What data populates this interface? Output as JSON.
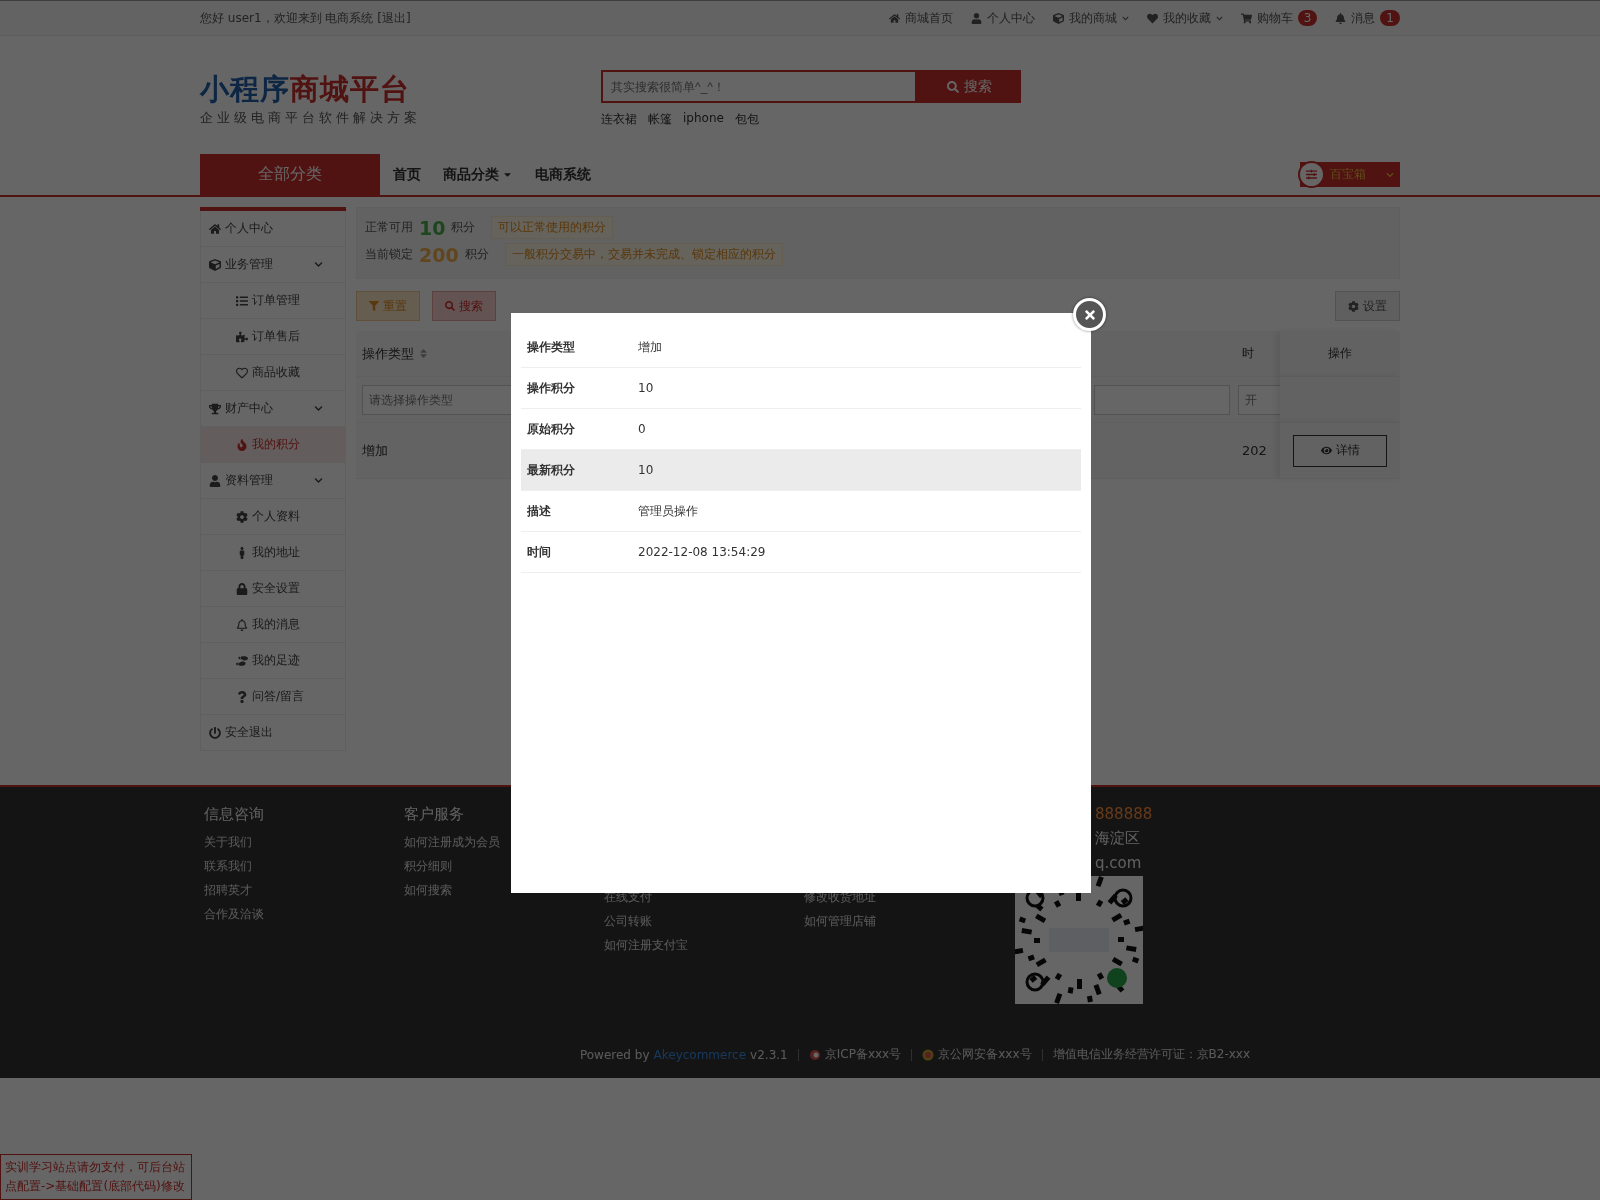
{
  "top_bar": {
    "greeting": "您好 user1，欢迎来到 电商系统",
    "logout": "[退出]",
    "links": [
      {
        "label": "商城首页",
        "dropdown": false
      },
      {
        "label": "个人中心",
        "dropdown": false
      },
      {
        "label": "我的商城",
        "dropdown": true
      },
      {
        "label": "我的收藏",
        "dropdown": true
      },
      {
        "label": "购物车",
        "dropdown": false,
        "badge": "3"
      },
      {
        "label": "消息",
        "dropdown": false,
        "badge": "1"
      }
    ]
  },
  "logo": {
    "title_blue": "小程序",
    "title_red": "商城平台",
    "subtitle": "企业级电商平台软件解决方案"
  },
  "search": {
    "placeholder": "其实搜索很简单^_^！",
    "button": "搜索",
    "hot_words": [
      "连衣裙",
      "帐篷",
      "iphone",
      "包包"
    ]
  },
  "nav": {
    "all_categories": "全部分类",
    "items": [
      {
        "label": "首页",
        "dropdown": false
      },
      {
        "label": "商品分类",
        "dropdown": true
      },
      {
        "label": "电商系统",
        "dropdown": false
      }
    ],
    "toolbox": "百宝箱"
  },
  "sidebar": {
    "items": [
      {
        "label": "个人中心",
        "selected": false
      },
      {
        "label": "业务管理",
        "selected": false,
        "expanded": true,
        "children": [
          {
            "label": "订单管理",
            "selected": false
          },
          {
            "label": "订单售后",
            "selected": false
          },
          {
            "label": "商品收藏",
            "selected": false
          }
        ]
      },
      {
        "label": "财产中心",
        "selected": false,
        "expanded": true,
        "children": [
          {
            "label": "我的积分",
            "selected": true
          }
        ]
      },
      {
        "label": "资料管理",
        "selected": false,
        "expanded": true,
        "children": [
          {
            "label": "个人资料",
            "selected": false
          },
          {
            "label": "我的地址",
            "selected": false
          },
          {
            "label": "安全设置",
            "selected": false
          },
          {
            "label": "我的消息",
            "selected": false
          },
          {
            "label": "我的足迹",
            "selected": false
          },
          {
            "label": "问答/留言",
            "selected": false
          }
        ]
      },
      {
        "label": "安全退出",
        "selected": false
      }
    ]
  },
  "points": [
    {
      "label": "正常可用",
      "value": "10",
      "unit": "积分",
      "note": "可以正常使用的积分",
      "kind": "available"
    },
    {
      "label": "当前锁定",
      "value": "200",
      "unit": "积分",
      "note": "一般积分交易中，交易并未完成、锁定相应的积分",
      "kind": "locked"
    }
  ],
  "toolbar": {
    "buttons": [
      {
        "kind": "reset",
        "label": "重置"
      },
      {
        "kind": "search",
        "label": "搜索"
      }
    ],
    "settings": "设置"
  },
  "table": {
    "columns": [
      "操作类型",
      "时",
      "操作"
    ],
    "filters": {
      "type_placeholder": "请选择操作类型",
      "time_placeholder": "开"
    },
    "rows": [
      {
        "type": "增加",
        "time": "202",
        "action": "详情"
      }
    ]
  },
  "modal": {
    "rows": [
      {
        "label": "操作类型",
        "value": "增加",
        "highlighted": false
      },
      {
        "label": "操作积分",
        "value": "10",
        "highlighted": false
      },
      {
        "label": "原始积分",
        "value": "0",
        "highlighted": false
      },
      {
        "label": "最新积分",
        "value": "10",
        "highlighted": true
      },
      {
        "label": "描述",
        "value": "管理员操作",
        "highlighted": false
      },
      {
        "label": "时间",
        "value": "2022-12-08 13:54:29",
        "highlighted": false
      }
    ]
  },
  "footer": {
    "columns": [
      {
        "title": "信息咨询",
        "links": [
          "关于我们",
          "联系我们",
          "招聘英才",
          "合作及洽谈"
        ]
      },
      {
        "title": "客户服务",
        "links": [
          "如何注册成为会员",
          "积分细则",
          "如何搜索"
        ]
      },
      {
        "links": [
          "在线支付",
          "公司转账",
          "如何注册支付宝"
        ]
      },
      {
        "links": [
          "修改收货地址",
          "如何管理店铺"
        ]
      }
    ],
    "contact": [
      "888888",
      "海淀区",
      "q.com"
    ],
    "powered_by": "Powered by",
    "brand": "Akeycommerce",
    "version": "v2.3.1",
    "icp": "京ICP备xxx号",
    "police": "京公网安备xxx号",
    "license": "增值电信业务经营许可证：京B2-xxx"
  },
  "notice": "实训学习站点请勿支付，可后台站点配置->基础配置(底部代码)修改"
}
